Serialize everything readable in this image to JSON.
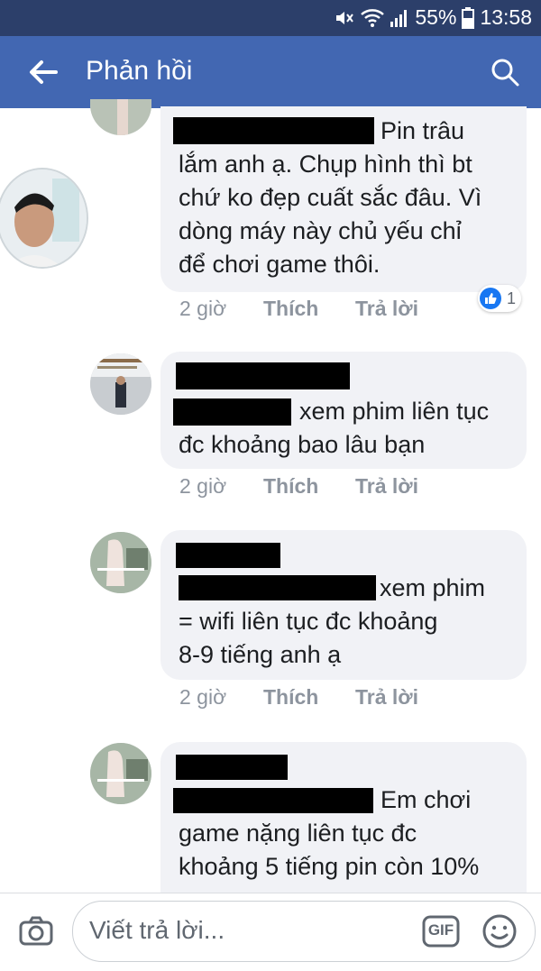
{
  "status": {
    "battery": "55%",
    "time": "13:58"
  },
  "header": {
    "title": "Phản hồi"
  },
  "comments": [
    {
      "lines": [
        "Pin trâu",
        "lắm anh ạ. Chụp hình thì bt",
        "chứ ko đẹp cuất sắc đâu. Vì",
        "dòng máy này chủ yếu chỉ",
        "để chơi game thôi."
      ],
      "time": "2 giờ",
      "like": "Thích",
      "reply": "Trả lời",
      "reaction_count": "1"
    },
    {
      "lines": [
        "xem phim liên tục",
        "đc khoảng bao lâu bạn"
      ],
      "time": "2 giờ",
      "like": "Thích",
      "reply": "Trả lời"
    },
    {
      "lines": [
        "xem phim",
        "= wifi liên tục đc khoảng",
        "8-9 tiếng anh ạ"
      ],
      "time": "2 giờ",
      "like": "Thích",
      "reply": "Trả lời"
    },
    {
      "lines": [
        "Em chơi",
        "game nặng liên tục đc",
        "khoảng 5 tiếng pin còn 10%"
      ]
    }
  ],
  "composer": {
    "placeholder": "Viết trả lời...",
    "gif_label": "GIF"
  },
  "icons": [
    "back-arrow-icon",
    "search-icon",
    "camera-icon",
    "gif-icon",
    "emoji-icon",
    "like-icon",
    "mute-icon",
    "wifi-icon",
    "signal-icon",
    "battery-icon"
  ],
  "colors": {
    "header": "#4267b2",
    "statusbar": "#2c3f6a",
    "bubble": "#f1f2f6",
    "like": "#1877f2"
  }
}
